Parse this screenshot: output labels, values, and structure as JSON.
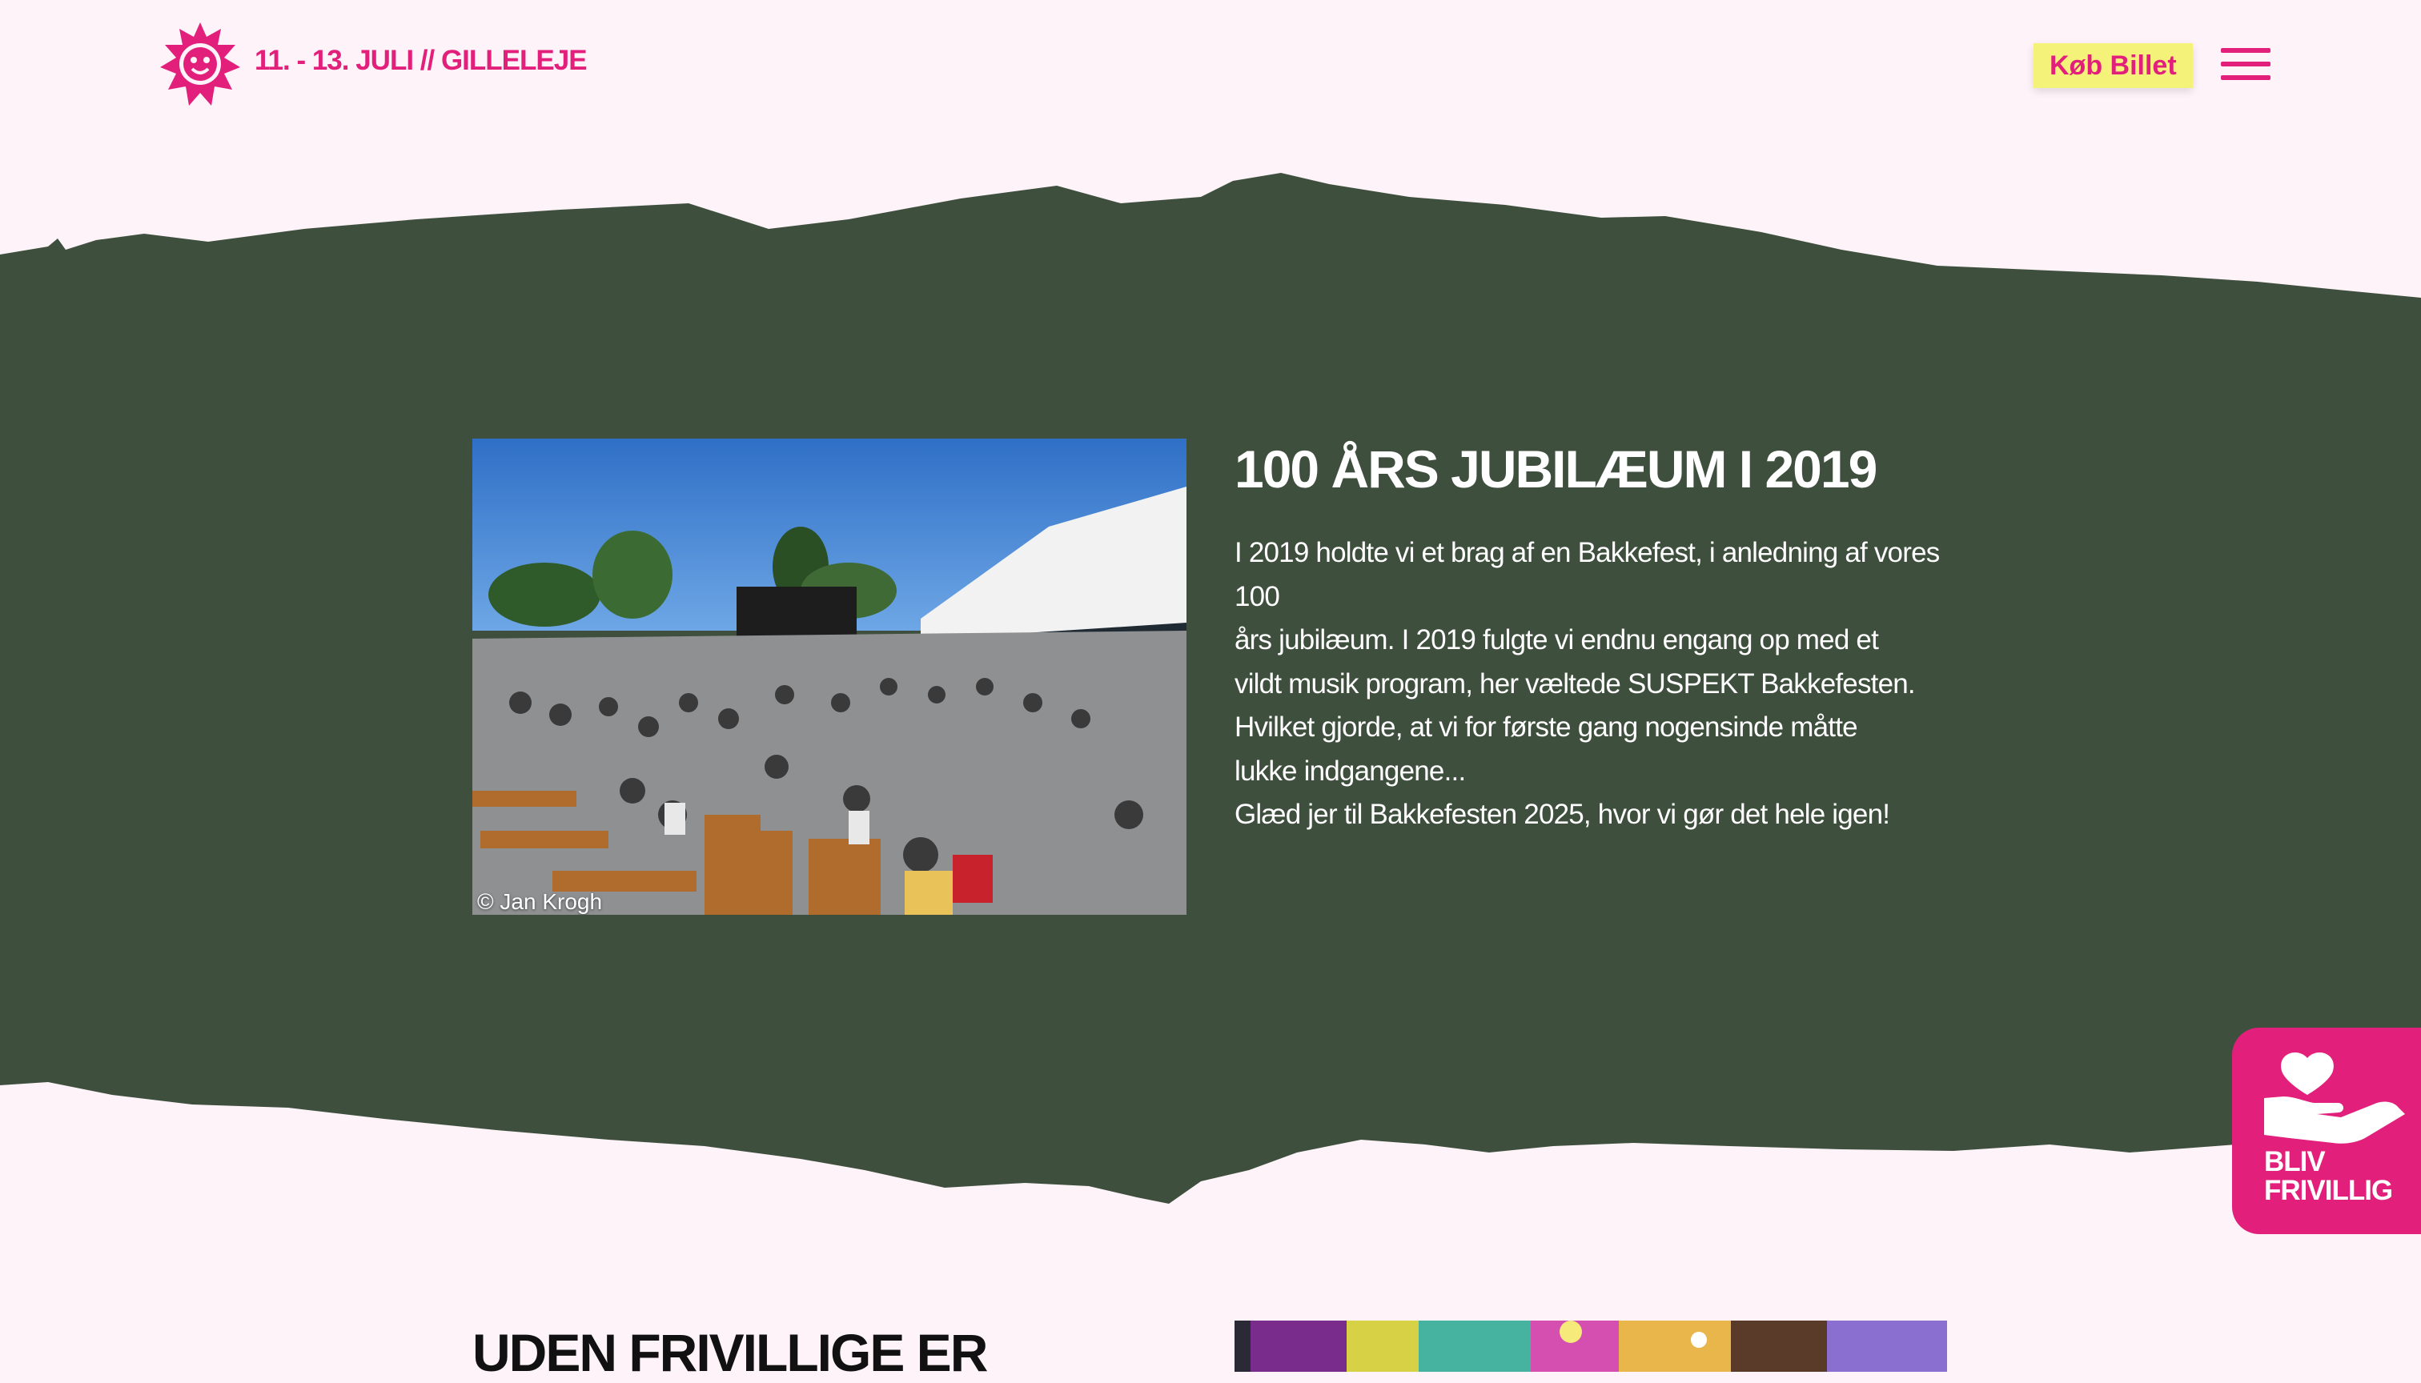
{
  "header": {
    "date_location": "11. - 13. JULI // GILLELEJE",
    "ticket_label": "Køb Billet",
    "logo_icon": "sun-face-logo-icon",
    "menu_icon": "hamburger-menu-icon"
  },
  "colors": {
    "page_background": "#fdf3f8",
    "band_green": "#3f4f3e",
    "brand_pink": "#e2207b",
    "ticket_yellow": "#f5f27a"
  },
  "feature": {
    "title": "100 ÅRS JUBILÆUM I 2019",
    "photo_credit": "© Jan Krogh",
    "body_lines": [
      "I 2019 holdte vi et brag af en Bakkefest, i anledning af vores 100",
      "års jubilæum. I 2019 fulgte vi endnu engang op med et",
      "vildt musik program, her væltede SUSPEKT Bakkefesten.",
      "Hvilket gjorde, at vi for første gang nogensinde måtte",
      "lukke indgangene...",
      "Glæd jer til Bakkefesten 2025, hvor vi gør det hele igen!"
    ]
  },
  "volunteer": {
    "label_line1": "BLIV",
    "label_line2": "FRIVILLIG",
    "icon": "heart-hand-icon"
  },
  "next_section": {
    "title": "UDEN FRIVILLIGE ER"
  }
}
